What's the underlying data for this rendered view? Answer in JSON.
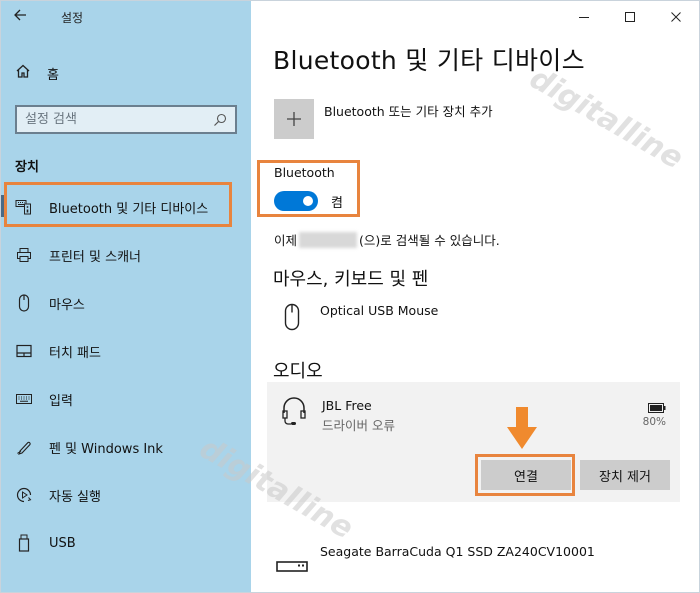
{
  "app": {
    "title": "설정",
    "back_icon": "arrow-left-icon"
  },
  "sidebar": {
    "home_label": "홈",
    "search_placeholder": "설정 검색",
    "section_title": "장치",
    "items": [
      {
        "label": "Bluetooth 및 기타 디바이스",
        "icon": "bluetooth-devices-icon",
        "selected": true
      },
      {
        "label": "프린터 및 스캐너",
        "icon": "printer-icon"
      },
      {
        "label": "마우스",
        "icon": "mouse-icon"
      },
      {
        "label": "터치 패드",
        "icon": "touchpad-icon"
      },
      {
        "label": "입력",
        "icon": "keyboard-icon"
      },
      {
        "label": "펜 및 Windows Ink",
        "icon": "pen-icon"
      },
      {
        "label": "자동 실행",
        "icon": "autoplay-icon"
      },
      {
        "label": "USB",
        "icon": "usb-icon"
      }
    ]
  },
  "window_controls": {
    "minimize": "—",
    "maximize": "☐",
    "close": "✕"
  },
  "main": {
    "page_title": "Bluetooth 및 기타 디바이스",
    "add_device_label": "Bluetooth 또는 기타 장치 추가",
    "add_icon": "+",
    "bluetooth": {
      "label": "Bluetooth",
      "state": "켬",
      "on": true
    },
    "discover_prefix": "이제",
    "discover_suffix": "(으)로 검색될 수 있습니다.",
    "mouse_section": {
      "title": "마우스, 키보드 및 펜",
      "devices": [
        {
          "name": "Optical USB Mouse"
        }
      ]
    },
    "audio_section": {
      "title": "오디오",
      "devices": [
        {
          "name": "JBL Free",
          "status": "드라이버 오류",
          "battery": "80%",
          "connect_label": "연결",
          "remove_label": "장치 제거"
        }
      ]
    },
    "other_devices": [
      {
        "name": "Seagate BarraCuda Q1 SSD ZA240CV10001"
      }
    ]
  },
  "annotations": {
    "highlight_color": "#e8843e",
    "watermark_text": "digitalline"
  },
  "colors": {
    "sidebar_bg": "#a9d4ea",
    "toggle_on": "#0078d7",
    "button_bg": "#cccccc"
  }
}
